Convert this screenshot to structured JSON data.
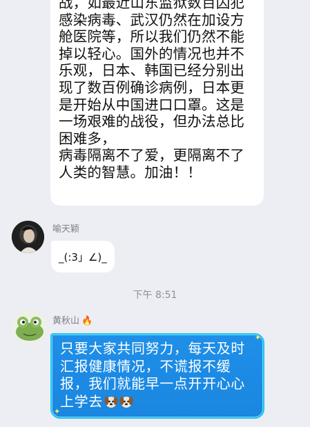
{
  "messages": [
    {
      "lines": [
        "战，如最近山东监狱数百囚犯",
        "感染病毒、武汉仍然在加设方",
        "舱医院等，所以我们仍然不能",
        "掉以轻心。国外的情况也并不",
        "乐观，日本、韩国已经分别出",
        "现了数百例确诊病例，日本更",
        "是开始从中国进口口罩。这是",
        "一场艰难的战役，但办法总比",
        "困难多，",
        "病毒隔离不了爱，更隔离不了",
        "人类的智慧。加油！！"
      ]
    },
    {
      "sender": "喻天颖",
      "text": "_(:3」∠)_"
    },
    {
      "sender": "黄秋山",
      "lines": [
        "只要大家共同努力，每天及时",
        "汇报健康情况，不谎报不缓",
        "报，我们就能早一点开开心心",
        "上学去"
      ]
    }
  ],
  "timestamp": "下午 8:51",
  "icons": {
    "fire": "🔥",
    "dog": "dog-face-emoji"
  },
  "colors": {
    "background": "#eceef4",
    "bubble_blue": "#1f8fe8",
    "bubble_border": "#19c5f2"
  }
}
